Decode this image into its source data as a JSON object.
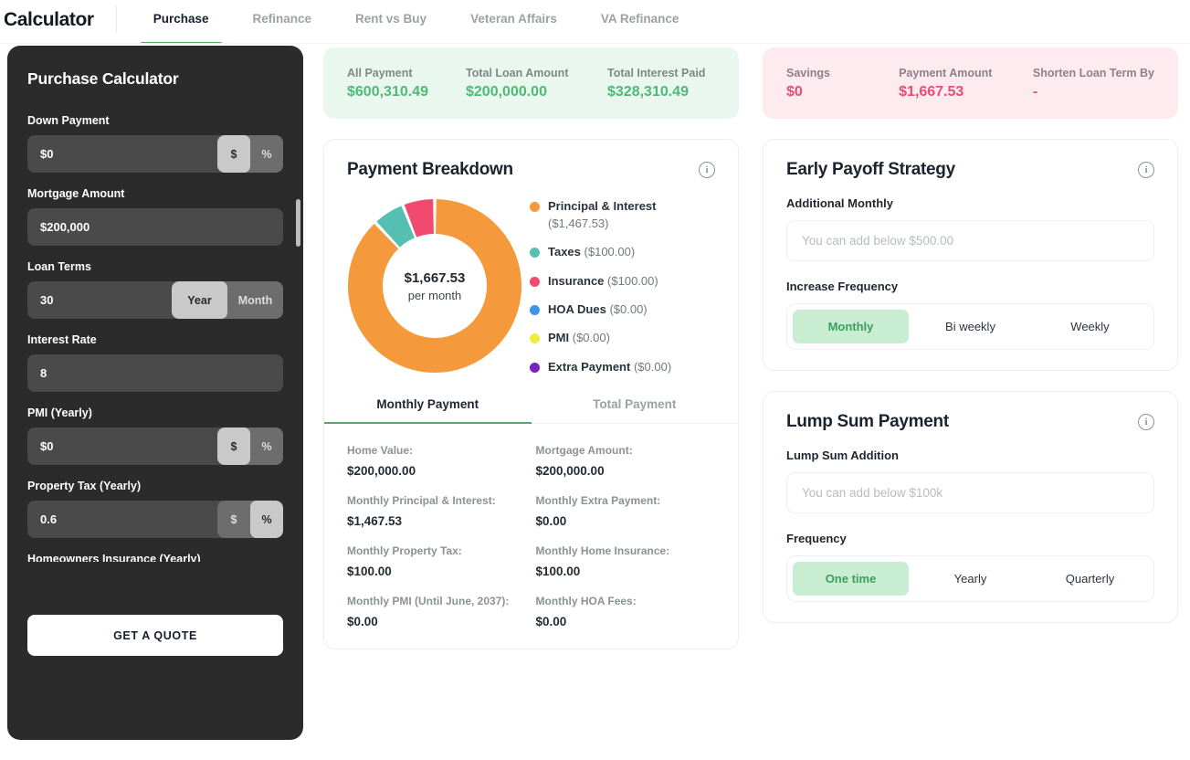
{
  "nav": {
    "brand": "Calculator",
    "items": [
      {
        "label": "Purchase",
        "active": true
      },
      {
        "label": "Refinance",
        "active": false
      },
      {
        "label": "Rent vs Buy",
        "active": false
      },
      {
        "label": "Veteran Affairs",
        "active": false
      },
      {
        "label": "VA Refinance",
        "active": false
      }
    ]
  },
  "sidebar": {
    "title": "Purchase Calculator",
    "fields": [
      {
        "label": "Down Payment",
        "value": "$0",
        "toggle": [
          "$",
          "%"
        ],
        "active": "$"
      },
      {
        "label": "Mortgage Amount",
        "value": "$200,000",
        "toggle": null,
        "active": null
      },
      {
        "label": "Loan Terms",
        "value": "30",
        "toggle": [
          "Year",
          "Month"
        ],
        "active": "Year"
      },
      {
        "label": "Interest Rate",
        "value": "8",
        "toggle": null,
        "active": null
      },
      {
        "label": "PMI (Yearly)",
        "value": "$0",
        "toggle": [
          "$",
          "%"
        ],
        "active": "$"
      },
      {
        "label": "Property Tax (Yearly)",
        "value": "0.6",
        "toggle": [
          "$",
          "%"
        ],
        "active": "%"
      }
    ],
    "cut_off_label": "Homeowners Insurance (Yearly)",
    "quote_button": "GET A QUOTE"
  },
  "summary_green": {
    "accent": "#4cbb76",
    "stats": [
      {
        "key": "All Payment",
        "value": "$600,310.49"
      },
      {
        "key": "Total Loan Amount",
        "value": "$200,000.00"
      },
      {
        "key": "Total Interest Paid",
        "value": "$328,310.49"
      }
    ]
  },
  "summary_pink": {
    "accent": "#ef4b72",
    "stats": [
      {
        "key": "Savings",
        "value": "$0"
      },
      {
        "key": "Payment Amount",
        "value": "$1,667.53"
      },
      {
        "key": "Shorten Loan Term By",
        "value": "-"
      }
    ]
  },
  "payment_breakdown": {
    "title": "Payment Breakdown",
    "center_amount": "$1,667.53",
    "center_sub": "per month",
    "tabs": [
      {
        "label": "Monthly Payment",
        "active": true
      },
      {
        "label": "Total Payment",
        "active": false
      }
    ],
    "details": [
      {
        "key": "Home Value:",
        "value": "$200,000.00"
      },
      {
        "key": "Mortgage Amount:",
        "value": "$200,000.00"
      },
      {
        "key": "Monthly Principal & Interest:",
        "value": "$1,467.53"
      },
      {
        "key": "Monthly Extra Payment:",
        "value": "$0.00"
      },
      {
        "key": "Monthly Property Tax:",
        "value": "$100.00"
      },
      {
        "key": "Monthly Home Insurance:",
        "value": "$100.00"
      },
      {
        "key": "Monthly PMI (Until June, 2037):",
        "value": "$0.00"
      },
      {
        "key": "Monthly HOA Fees:",
        "value": "$0.00"
      }
    ]
  },
  "chart_data": {
    "type": "pie",
    "title": "Payment Breakdown",
    "subtitle": "$1,667.53 per month",
    "legend_position": "right",
    "center_label": "$1,667.53 per month",
    "total": 1667.53,
    "categories": [
      "Principal & Interest",
      "Taxes",
      "Insurance",
      "HOA Dues",
      "PMI",
      "Extra Payment"
    ],
    "values": [
      1467.53,
      100.0,
      100.0,
      0.0,
      0.0,
      0.0
    ],
    "value_labels": [
      "($1,467.53)",
      "($100.00)",
      "($100.00)",
      "($0.00)",
      "($0.00)",
      "($0.00)"
    ],
    "colors": [
      "#f59a3c",
      "#54bfb2",
      "#f2496e",
      "#3b95e8",
      "#eded3c",
      "#7a21c4"
    ],
    "percentages": [
      87.98,
      5.996,
      5.996,
      0.0,
      0.0,
      0.0
    ]
  },
  "early_payoff": {
    "title": "Early Payoff Strategy",
    "field_label": "Additional Monthly",
    "placeholder": "You can add below $500.00",
    "value": "",
    "frequency_label": "Increase Frequency",
    "options": [
      {
        "label": "Monthly",
        "active": true
      },
      {
        "label": "Bi weekly",
        "active": false
      },
      {
        "label": "Weekly",
        "active": false
      }
    ]
  },
  "lump_sum": {
    "title": "Lump Sum Payment",
    "field_label": "Lump Sum Addition",
    "placeholder": "You can add below $100k",
    "value": "",
    "frequency_label": "Frequency",
    "options": [
      {
        "label": "One time",
        "active": true
      },
      {
        "label": "Yearly",
        "active": false
      },
      {
        "label": "Quarterly",
        "active": false
      }
    ]
  }
}
